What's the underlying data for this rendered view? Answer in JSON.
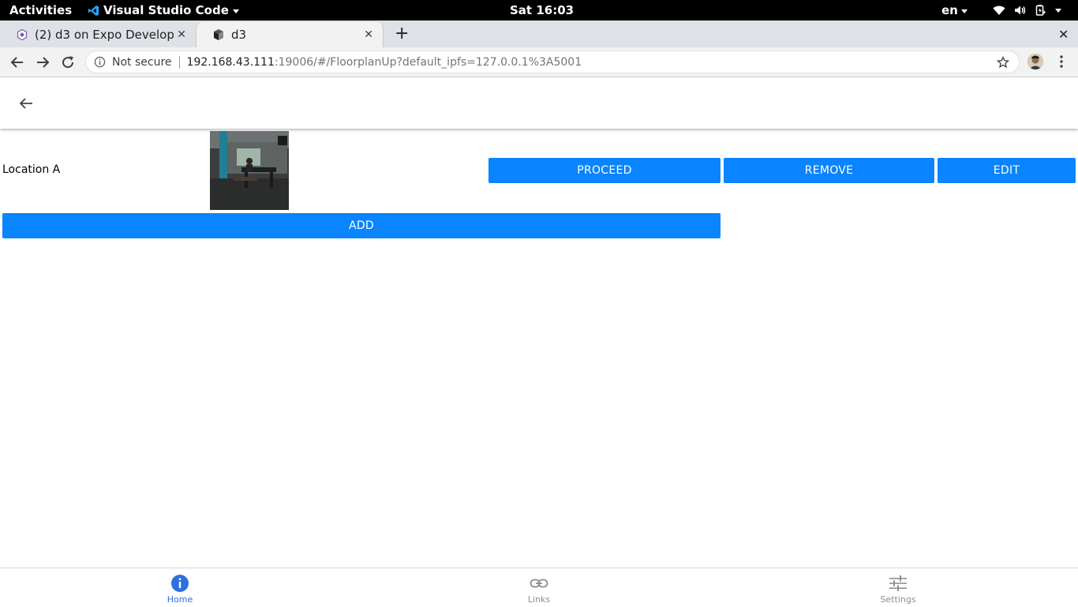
{
  "system_bar": {
    "activities": "Activities",
    "app_name": "Visual Studio Code",
    "clock": "Sat 16:03",
    "language": "en",
    "icons": [
      "wifi-icon",
      "volume-icon",
      "battery-icon",
      "power-menu-icon"
    ]
  },
  "browser": {
    "tabs": [
      {
        "title": "(2) d3 on Expo Develop",
        "favicon": "expo-icon",
        "active": false
      },
      {
        "title": "d3",
        "favicon": "app-cube-icon",
        "active": true
      }
    ],
    "address": {
      "security": "Not secure",
      "host": "192.168.43.111",
      "path": ":19006/#/FloorplanUp?default_ipfs=127.0.0.1%3A5001"
    }
  },
  "app": {
    "locations": [
      {
        "name": "Location A",
        "image_icon": "location-photo"
      }
    ],
    "actions": {
      "proceed": "PROCEED",
      "remove": "REMOVE",
      "edit": "EDIT",
      "add": "ADD"
    },
    "accent_color": "#0a84ff"
  },
  "bottom_nav": {
    "home": "Home",
    "links": "Links",
    "settings": "Settings",
    "active_color": "#2f6fdf",
    "inactive_color": "#8e8e93"
  }
}
